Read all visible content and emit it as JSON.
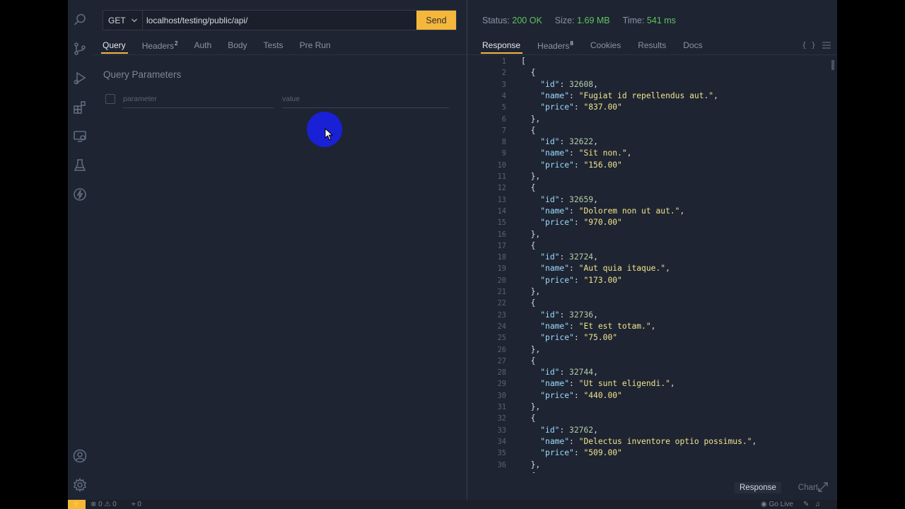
{
  "activity_bar": {
    "icons": [
      "search-icon",
      "source-control-icon",
      "run-debug-icon",
      "extensions-icon",
      "remote-explorer-icon",
      "testing-icon",
      "thunder-client-icon",
      "account-icon",
      "settings-gear-icon"
    ]
  },
  "request": {
    "method": "GET",
    "url": "localhost/testing/public/api/",
    "send_label": "Send",
    "tabs": [
      {
        "label": "Query",
        "badge": "",
        "active": true
      },
      {
        "label": "Headers",
        "badge": "2",
        "active": false
      },
      {
        "label": "Auth",
        "badge": "",
        "active": false
      },
      {
        "label": "Body",
        "badge": "",
        "active": false
      },
      {
        "label": "Tests",
        "badge": "",
        "active": false
      },
      {
        "label": "Pre Run",
        "badge": "",
        "active": false
      }
    ],
    "query_title": "Query Parameters",
    "param_placeholder": "parameter",
    "value_placeholder": "value"
  },
  "response": {
    "status_label": "Status:",
    "status_value": "200 OK",
    "size_label": "Size:",
    "size_value": "1.69 MB",
    "time_label": "Time:",
    "time_value": "541 ms",
    "tabs": [
      {
        "label": "Response",
        "badge": "",
        "active": true
      },
      {
        "label": "Headers",
        "badge": "8",
        "active": false
      },
      {
        "label": "Cookies",
        "badge": "",
        "active": false
      },
      {
        "label": "Results",
        "badge": "",
        "active": false
      },
      {
        "label": "Docs",
        "badge": "",
        "active": false
      }
    ],
    "format_icon_text": "{ }",
    "items": [
      {
        "id": "32608",
        "name": "Fugiat id repellendus aut.",
        "price": "837.00"
      },
      {
        "id": "32622",
        "name": "Sit non.",
        "price": "156.00"
      },
      {
        "id": "32659",
        "name": "Dolorem non ut aut.",
        "price": "970.00"
      },
      {
        "id": "32724",
        "name": "Aut quia itaque.",
        "price": "173.00"
      },
      {
        "id": "32736",
        "name": "Et est totam.",
        "price": "75.00"
      },
      {
        "id": "32744",
        "name": "Ut sunt eligendi.",
        "price": "440.00"
      },
      {
        "id": "32762",
        "name": "Delectus inventore optio possimus.",
        "price": "509.00"
      }
    ],
    "line_count": 37,
    "bottom_tabs": [
      {
        "label": "Response",
        "active": true
      },
      {
        "label": "Chart",
        "active": false
      }
    ]
  },
  "statusbar": {
    "errors": "0",
    "warnings": "0",
    "ports": "0",
    "go_live": "Go Live"
  }
}
